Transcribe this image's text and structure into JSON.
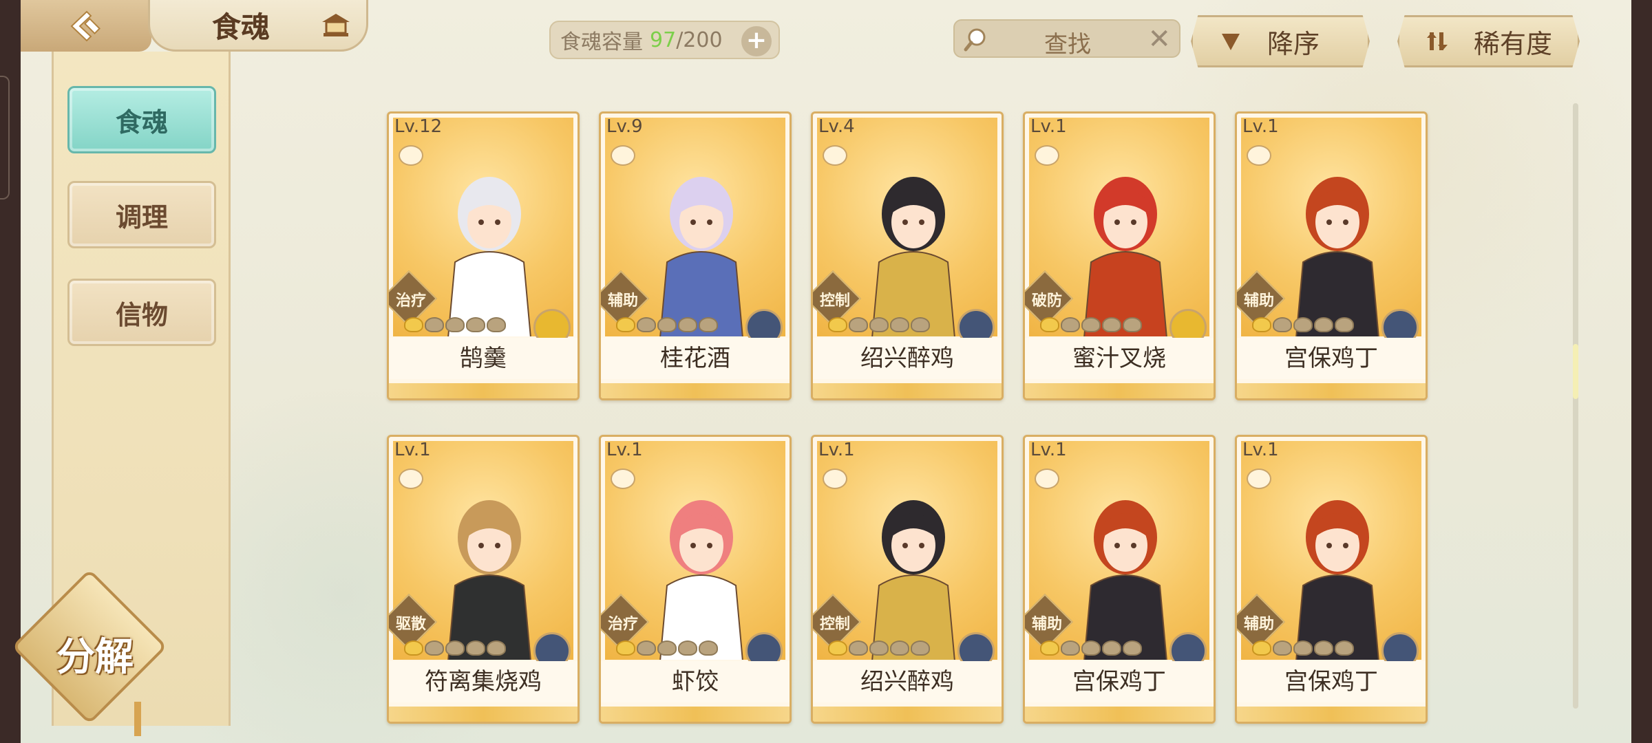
{
  "header": {
    "title": "食魂",
    "capacity_label": "食魂容量",
    "capacity_current": "97",
    "capacity_max": "/200",
    "capacity_plus": "+",
    "search_placeholder": "查找",
    "search_clear": "✕",
    "sort_order_label": "降序",
    "sort_by_label": "稀有度"
  },
  "sidebar": {
    "items": [
      {
        "label": "食魂",
        "active": true
      },
      {
        "label": "调理",
        "active": false
      },
      {
        "label": "信物",
        "active": false
      }
    ],
    "decompose_label": "分解"
  },
  "colors": {
    "accent_teal": "#83d4c6",
    "capacity_current": "#7ccf4a",
    "card_gold": "#f0b444"
  },
  "cards": [
    {
      "level": "Lv.12",
      "name": "鹄羹",
      "role": "治疗",
      "stars_on": 1,
      "emblem": "flower-gold"
    },
    {
      "level": "Lv.9",
      "name": "桂花酒",
      "role": "辅助",
      "stars_on": 1,
      "emblem": "flower-blue"
    },
    {
      "level": "Lv.4",
      "name": "绍兴醉鸡",
      "role": "控制",
      "stars_on": 1,
      "emblem": "flower-blue"
    },
    {
      "level": "Lv.1",
      "name": "蜜汁叉烧",
      "role": "破防",
      "stars_on": 1,
      "emblem": "flower-gold"
    },
    {
      "level": "Lv.1",
      "name": "宫保鸡丁",
      "role": "辅助",
      "stars_on": 1,
      "emblem": "flower-blue"
    },
    {
      "level": "Lv.1",
      "name": "符离集烧鸡",
      "role": "驱散",
      "stars_on": 1,
      "emblem": "flower-blue"
    },
    {
      "level": "Lv.1",
      "name": "虾饺",
      "role": "治疗",
      "stars_on": 1,
      "emblem": "flower-blue"
    },
    {
      "level": "Lv.1",
      "name": "绍兴醉鸡",
      "role": "控制",
      "stars_on": 1,
      "emblem": "flower-blue"
    },
    {
      "level": "Lv.1",
      "name": "宫保鸡丁",
      "role": "辅助",
      "stars_on": 1,
      "emblem": "flower-blue"
    },
    {
      "level": "Lv.1",
      "name": "宫保鸡丁",
      "role": "辅助",
      "stars_on": 1,
      "emblem": "flower-blue"
    }
  ]
}
